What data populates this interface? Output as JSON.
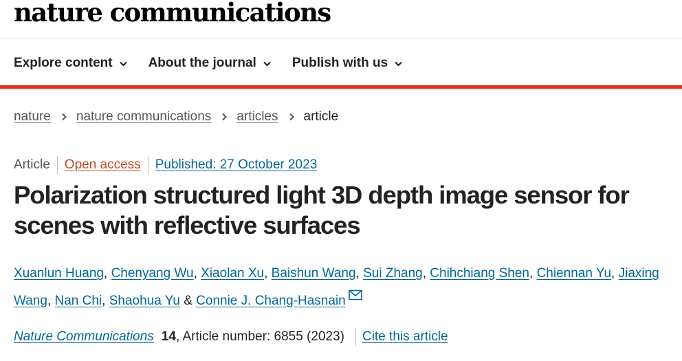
{
  "header": {
    "brand": "nature communications"
  },
  "nav": {
    "items": [
      {
        "label": "Explore content"
      },
      {
        "label": "About the journal"
      },
      {
        "label": "Publish with us"
      }
    ]
  },
  "breadcrumb": {
    "items": [
      "nature",
      "nature communications",
      "articles"
    ],
    "current": "article"
  },
  "article": {
    "type": "Article",
    "access": "Open access",
    "published": "Published: 27 October 2023",
    "title": "Polarization structured light 3D depth image sensor for scenes with reflective surfaces",
    "authors": [
      "Xuanlun Huang",
      "Chenyang Wu",
      "Xiaolan Xu",
      "Baishun Wang",
      "Sui Zhang",
      "Chihchiang Shen",
      "Chiennan Yu",
      "Jiaxing Wang",
      "Nan Chi",
      "Shaohua Yu",
      "Connie J. Chang-Hasnain"
    ],
    "author_separator": ", ",
    "author_last_separator": " & ",
    "journal": "Nature Communications",
    "volume": "14",
    "article_number": ", Article number: 6855 (2023)",
    "cite_label": "Cite this article"
  },
  "colors": {
    "accent_red": "#e3301e",
    "link_blue": "#006699",
    "open_access_orange": "#c4471d"
  },
  "icons": {
    "dropdown": "chevron-down-icon",
    "breadcrumb_separator": "chevron-right-icon",
    "corresponding_author": "envelope-icon"
  }
}
